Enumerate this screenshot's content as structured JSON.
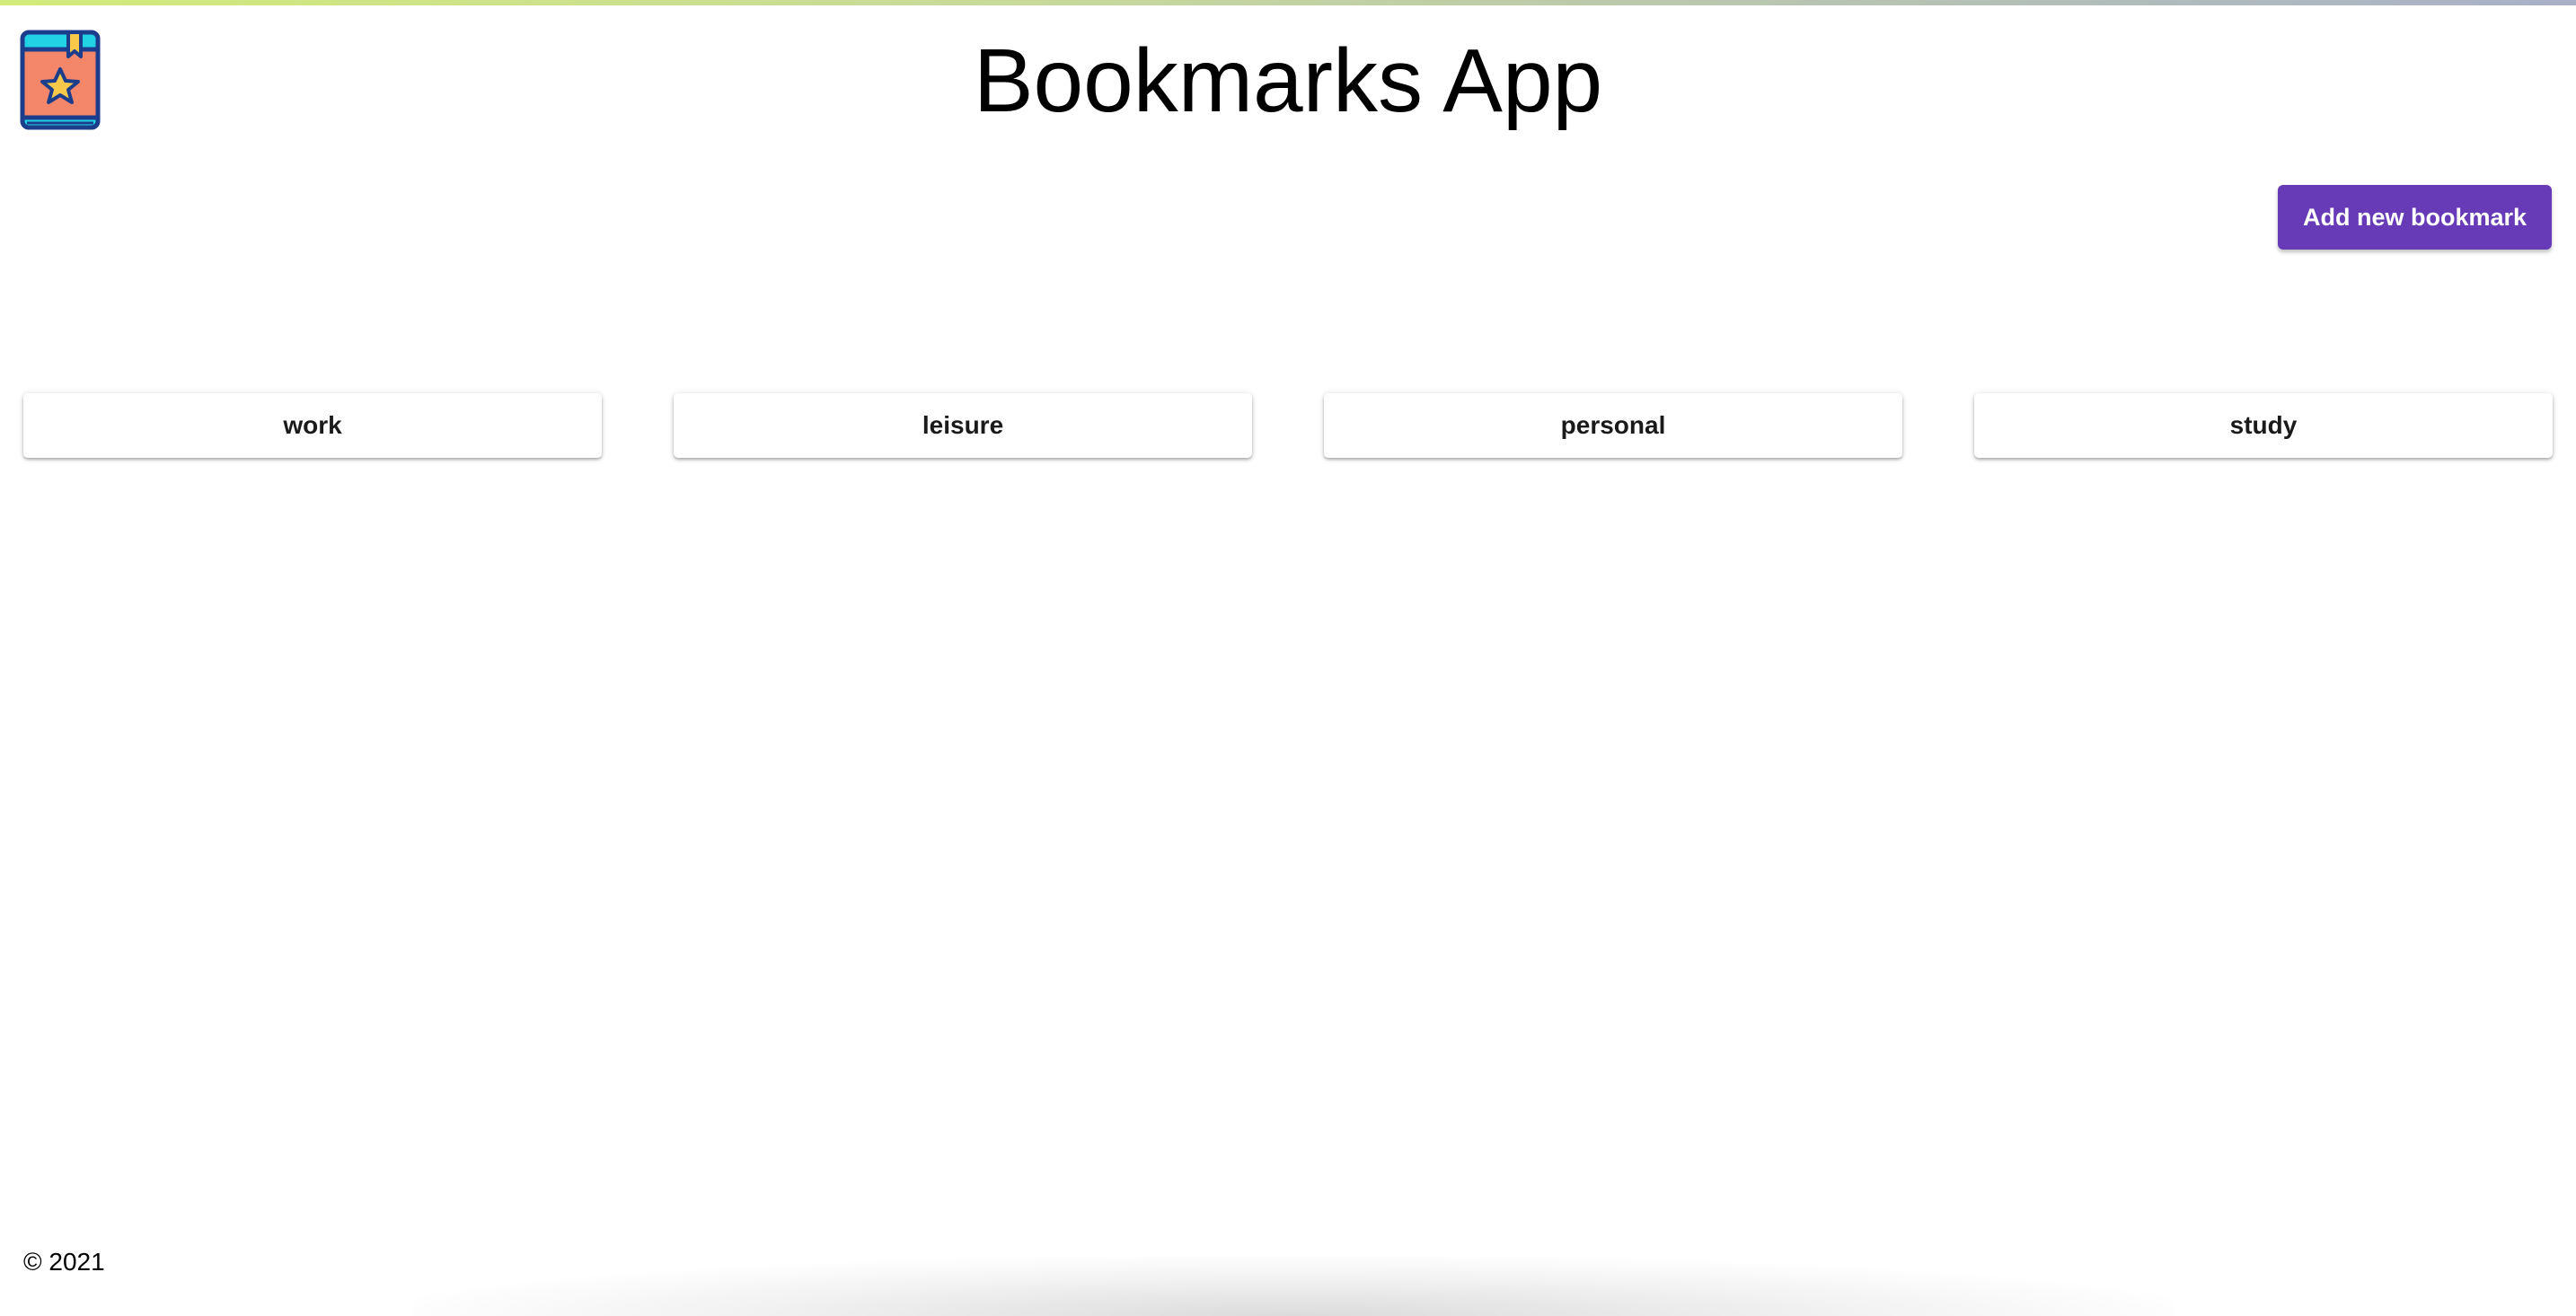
{
  "header": {
    "title": "Bookmarks App",
    "logo_icon": "bookmark-book-star-icon"
  },
  "toolbar": {
    "add_label": "Add new bookmark"
  },
  "categories": [
    {
      "label": "work"
    },
    {
      "label": "leisure"
    },
    {
      "label": "personal"
    },
    {
      "label": "study"
    }
  ],
  "footer": {
    "text": "© 2021"
  },
  "colors": {
    "accent": "#673ab7",
    "logo_cover": "#f4876a",
    "logo_spine": "#22d3e6",
    "logo_star": "#f7c84a",
    "logo_outline": "#1c3d8c"
  }
}
